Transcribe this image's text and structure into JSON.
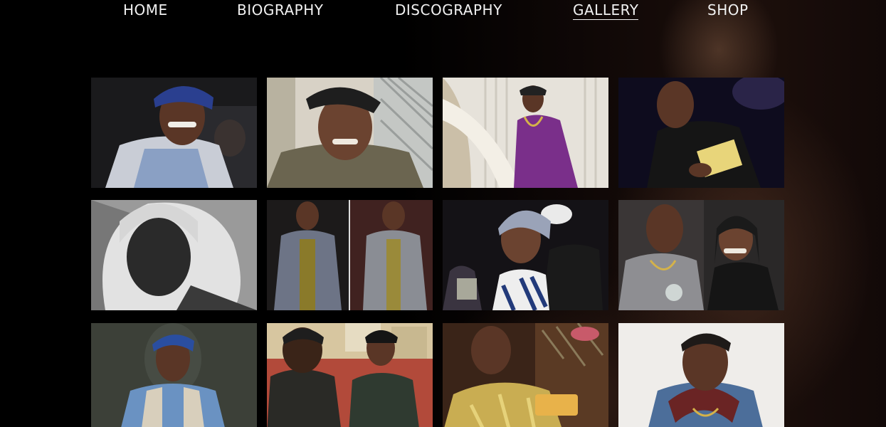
{
  "nav": {
    "items": [
      {
        "label": "HOME"
      },
      {
        "label": "BIOGRAPHY"
      },
      {
        "label": "DISCOGRAPHY"
      },
      {
        "label": "GALLERY"
      },
      {
        "label": "SHOP"
      }
    ],
    "active": "GALLERY"
  },
  "gallery": {
    "photos": [
      {
        "subject": "man in blue bandana and striped shirt, smiling"
      },
      {
        "subject": "man in black cap and olive hoodie, smiling"
      },
      {
        "subject": "man in purple shirt with gold chain by curtains"
      },
      {
        "subject": "man in black leather jacket holding paper"
      },
      {
        "subject": "black and white portrait in hood"
      },
      {
        "subject": "two photos of man in grey suit with gold vest"
      },
      {
        "subject": "man in grey beanie with crowd"
      },
      {
        "subject": "man in grey sweater with woman"
      },
      {
        "subject": "man in blue bandana and denim shirt"
      },
      {
        "subject": "two men in bandana and cap posing"
      },
      {
        "subject": "man in gold shirt at party"
      },
      {
        "subject": "man in red hoodie and denim jacket"
      }
    ]
  },
  "colors": {
    "background": "#000000",
    "nav_text": "#f1f1f1"
  }
}
